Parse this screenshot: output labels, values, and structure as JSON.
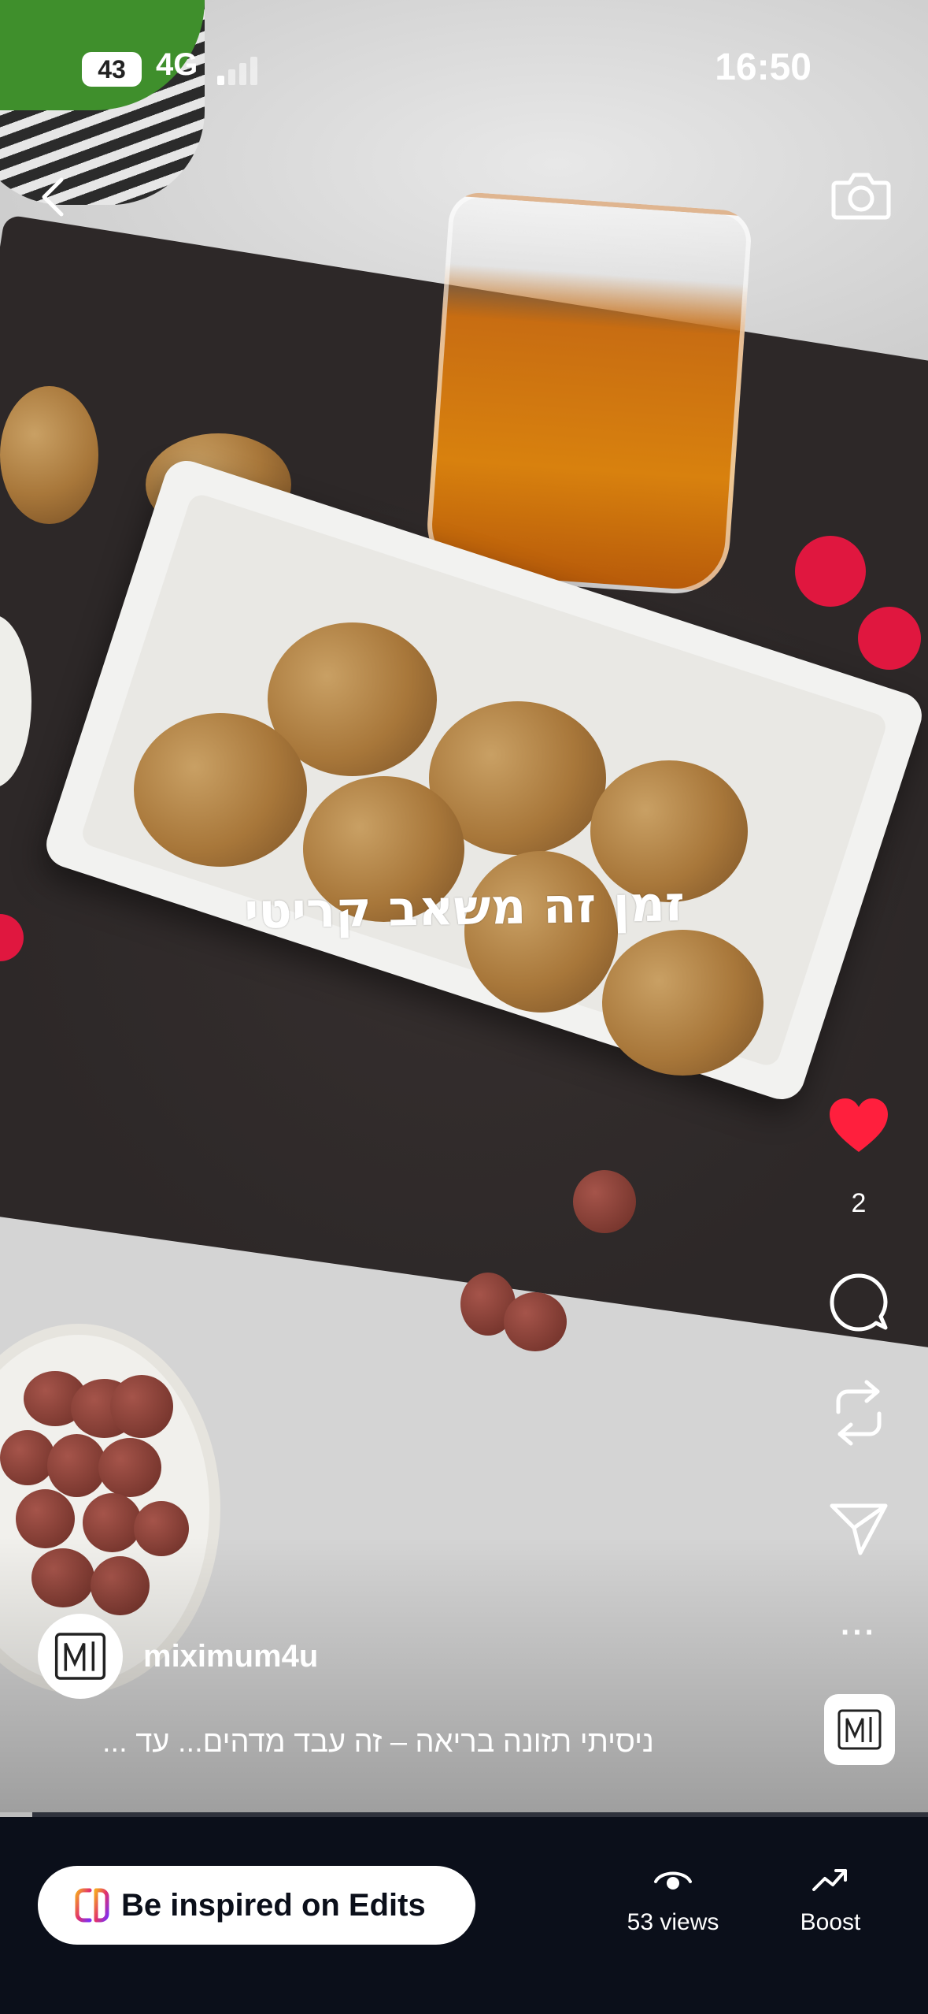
{
  "status_bar": {
    "battery": "43",
    "network": "4G",
    "time": "16:50"
  },
  "video": {
    "overlay_text": "זמן זה משאב קריטי"
  },
  "actions": {
    "like_count": "2",
    "more_label": "···"
  },
  "post": {
    "username": "miximum4u",
    "caption": "ניסיתי תזונה בריאה – זה עבד מדהים... עד ..."
  },
  "progress": {
    "fraction": 0.035
  },
  "bottom_bar": {
    "edits_label": "Be inspired on Edits",
    "views_label": "53 views",
    "boost_label": "Boost"
  },
  "colors": {
    "like_red": "#ff1f3d",
    "bar_background": "#0b0f1a"
  },
  "icons": [
    "back-icon",
    "camera-icon",
    "heart-icon",
    "comment-icon",
    "repost-icon",
    "share-icon",
    "more-icon",
    "eye-icon",
    "trend-icon",
    "edits-logo-icon"
  ]
}
